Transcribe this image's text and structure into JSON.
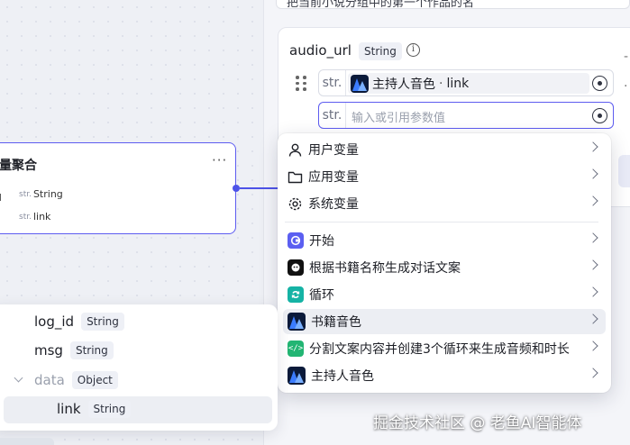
{
  "header": {
    "top_text": "把当前小说分组中的第一个作品的名"
  },
  "canvas_node": {
    "title": "量聚合",
    "more_label": "···",
    "rows": [
      {
        "tag": "str.",
        "type": "String"
      },
      {
        "tag": "str.",
        "type": "link"
      }
    ],
    "left_fragment": "l"
  },
  "param": {
    "name": "audio_url",
    "type": "String",
    "info_icon": "info-icon",
    "inputs": [
      {
        "prefix": "str.",
        "ref_source": "主持人音色",
        "ref_sep": "·",
        "ref_field": "link",
        "icon": "peaks-logo-icon"
      },
      {
        "prefix": "str.",
        "placeholder": "输入或引用参数值"
      }
    ]
  },
  "menu": {
    "items": [
      {
        "label": "用户变量",
        "icon": "user-icon"
      },
      {
        "label": "应用变量",
        "icon": "folder-icon"
      },
      {
        "label": "系统变量",
        "icon": "gear-icon"
      },
      {
        "label": "开始",
        "icon": "start-icon",
        "color": "#5b5ff1"
      },
      {
        "label": "根据书籍名称生成对话文案",
        "icon": "llm-icon",
        "color": "#111111"
      },
      {
        "label": "循环",
        "icon": "loop-icon",
        "color": "#15b3a5"
      },
      {
        "label": "书籍音色",
        "icon": "peaks-logo-icon"
      },
      {
        "label": "分割文案内容并创建3个循环来生成音频和时长",
        "icon": "code-icon",
        "color": "#22b573"
      },
      {
        "label": "主持人音色",
        "icon": "peaks-logo-icon"
      }
    ],
    "highlighted_index": 6
  },
  "output_list": {
    "rows": [
      {
        "name": "log_id",
        "type": "String"
      },
      {
        "name": "msg",
        "type": "String"
      },
      {
        "name": "data",
        "type": "Object"
      },
      {
        "name": "link",
        "type": "String"
      }
    ]
  },
  "watermark": "掘金技术社区 @ 老鱼AI智能体"
}
